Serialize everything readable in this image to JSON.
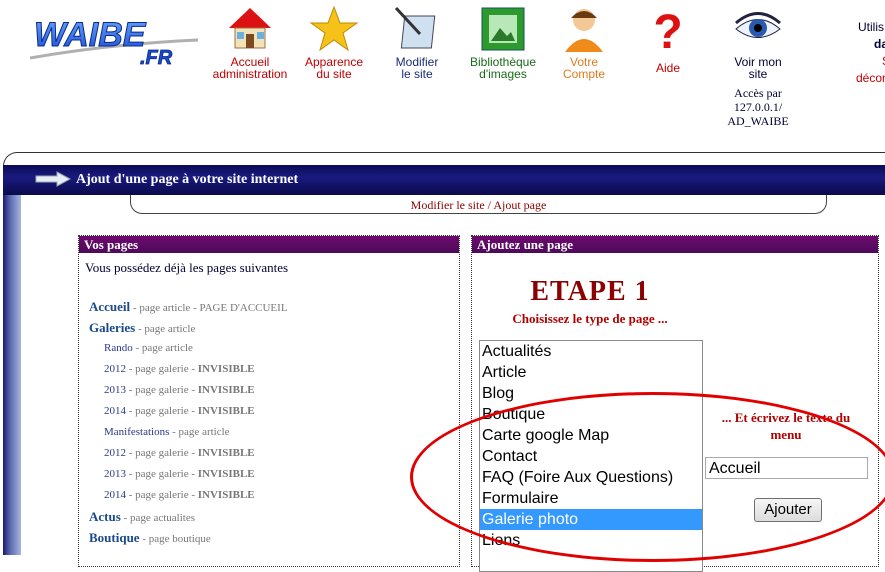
{
  "logo": {
    "text": "WAIBE",
    "suffix": ".FR"
  },
  "nav": [
    {
      "line1": "Accueil",
      "line2": "administration",
      "icon": "house-icon",
      "color": "red"
    },
    {
      "line1": "Apparence",
      "line2": "du site",
      "icon": "star-icon",
      "color": "red"
    },
    {
      "line1": "Modifier",
      "line2": "le site",
      "icon": "pen-tablet-icon",
      "color": "blue"
    },
    {
      "line1": "Bibliothèque",
      "line2": "d'images",
      "icon": "image-library-icon",
      "color": "green"
    },
    {
      "line1": "Votre",
      "line2": "Compte",
      "icon": "user-account-icon",
      "color": "orange"
    },
    {
      "line1": "Aide",
      "line2": "",
      "icon": "question-mark-icon",
      "color": "red"
    },
    {
      "line1": "Voir mon",
      "line2": "site",
      "icon": "eye-icon",
      "color": "navy"
    }
  ],
  "access": {
    "line1": "Accès par",
    "line2": "127.0.0.1/",
    "line3": "AD_WAIBE"
  },
  "user_fragments": {
    "line1": "Utilis",
    "line2": "da",
    "line3": "S",
    "line4": "décon"
  },
  "titlebar": {
    "title": "Ajout d'une page à votre site internet"
  },
  "breadcrumb": {
    "link": "Modifier le site",
    "sep": " / ",
    "current": "Ajout page"
  },
  "vos_pages": {
    "header": "Vos pages",
    "intro": "Vous possédez déjà les pages suivantes",
    "pages": [
      {
        "level": 0,
        "name": "Accueil",
        "type": " - page article - ",
        "extra": "PAGE D'ACCUEIL",
        "extra_bold": false
      },
      {
        "level": 0,
        "name": "Galeries",
        "type": " - page article",
        "extra": "",
        "extra_bold": false
      },
      {
        "level": 1,
        "name": "Rando",
        "type": " - page article",
        "extra": "",
        "extra_bold": false
      },
      {
        "level": 1,
        "name": "2012",
        "type": " - page galerie - ",
        "extra": "INVISIBLE",
        "extra_bold": true
      },
      {
        "level": 1,
        "name": "2013",
        "type": " - page galerie - ",
        "extra": "INVISIBLE",
        "extra_bold": true
      },
      {
        "level": 1,
        "name": "2014",
        "type": " - page galerie - ",
        "extra": "INVISIBLE",
        "extra_bold": true
      },
      {
        "level": 1,
        "name": "Manifestations",
        "type": " - page article",
        "extra": "",
        "extra_bold": false
      },
      {
        "level": 1,
        "name": "2012",
        "type": " - page galerie - ",
        "extra": "INVISIBLE",
        "extra_bold": true
      },
      {
        "level": 1,
        "name": "2013",
        "type": " - page galerie - ",
        "extra": "INVISIBLE",
        "extra_bold": true
      },
      {
        "level": 1,
        "name": "2014",
        "type": " - page galerie - ",
        "extra": "INVISIBLE",
        "extra_bold": true
      },
      {
        "level": 0,
        "name": "Actus",
        "type": " - page actualites",
        "extra": "",
        "extra_bold": false
      },
      {
        "level": 0,
        "name": "Boutique",
        "type": " - page boutique",
        "extra": "",
        "extra_bold": false
      }
    ]
  },
  "ajout": {
    "header": "Ajoutez une page",
    "step_title": "ETAPE 1",
    "step_subtitle": "Choisissez le type de page ...",
    "types": [
      "Actualités",
      "Article",
      "Blog",
      "Boutique",
      "Carte google Map",
      "Contact",
      "FAQ (Foire Aux Questions)",
      "Formulaire",
      "Galerie photo",
      "Liens"
    ],
    "selected_type": "Galerie photo",
    "menu_label": "... Et écrivez le texte du menu",
    "menu_value": "Accueil",
    "add_button": "Ajouter"
  },
  "colors": {
    "accent": "#1a1a80",
    "panel_header": "#5c0a64",
    "annotation": "#e10000"
  }
}
